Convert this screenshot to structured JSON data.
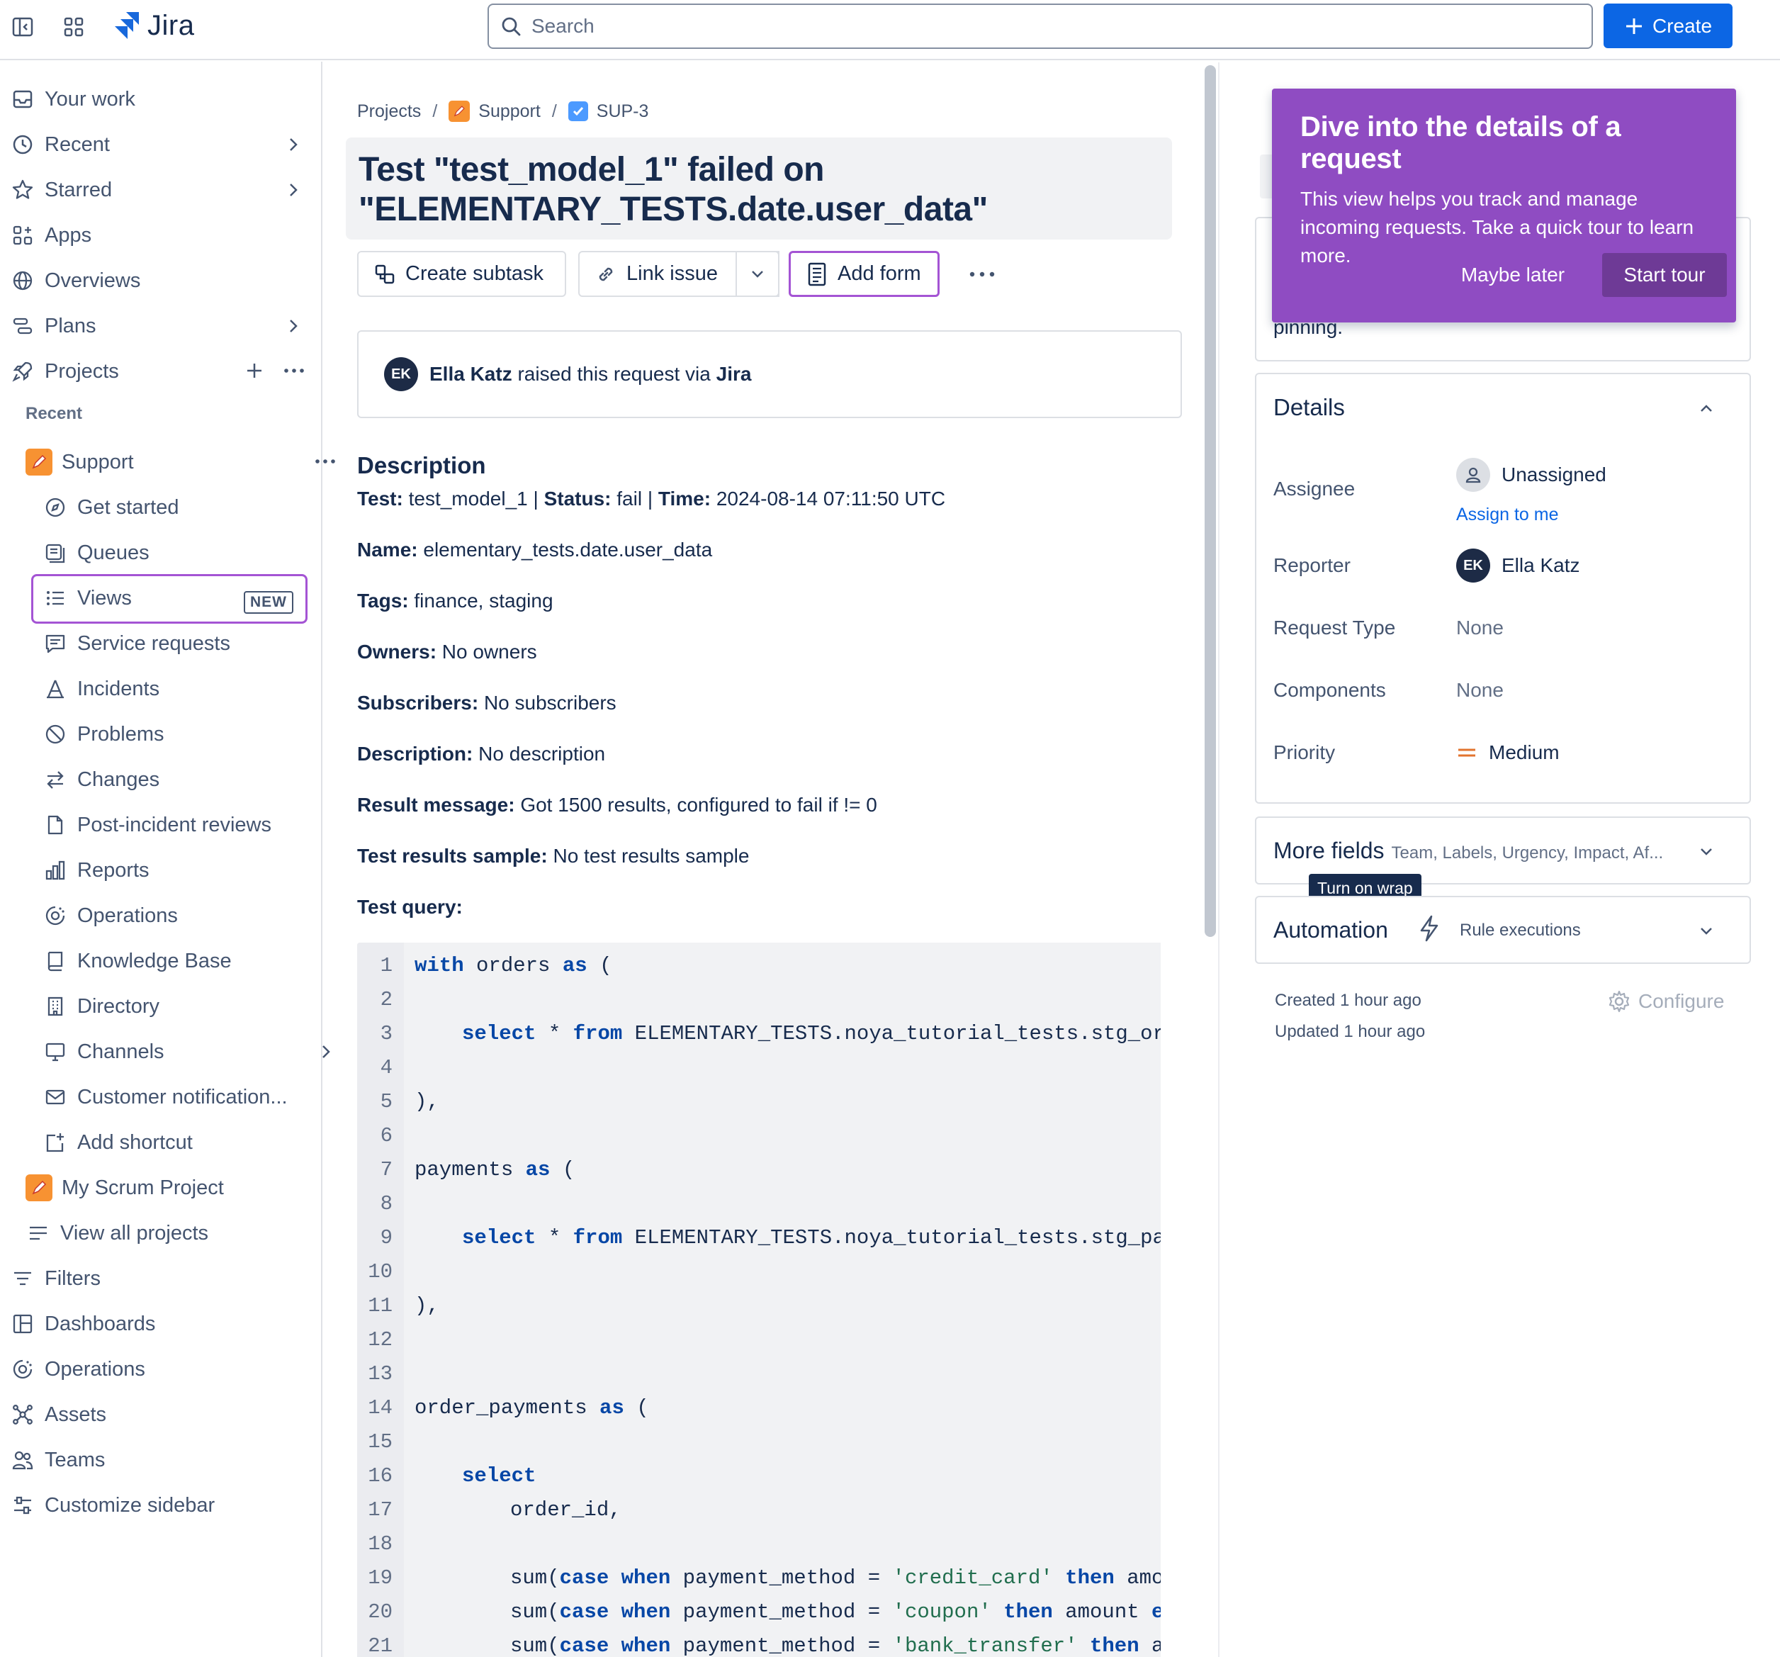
{
  "topbar": {
    "app_name": "Jira",
    "search_placeholder": "Search",
    "create_label": "Create"
  },
  "sidebar": {
    "your_work": "Your work",
    "recent": "Recent",
    "starred": "Starred",
    "apps": "Apps",
    "overviews": "Overviews",
    "plans": "Plans",
    "projects": "Projects",
    "recent_section": "Recent",
    "support": "Support",
    "support_items": [
      "Get started",
      "Queues",
      "Views",
      "Service requests",
      "Incidents",
      "Problems",
      "Changes",
      "Post-incident reviews",
      "Reports",
      "Operations",
      "Knowledge Base",
      "Directory",
      "Channels",
      "Customer notification...",
      "Add shortcut"
    ],
    "new_badge": "NEW",
    "my_scrum": "My Scrum Project",
    "view_all": "View all projects",
    "bottom_items": [
      "Filters",
      "Dashboards",
      "Operations",
      "Assets",
      "Teams",
      "Customize sidebar"
    ]
  },
  "breadcrumb": {
    "projects": "Projects",
    "support": "Support",
    "issue": "SUP-3"
  },
  "issue": {
    "title": "Test \"test_model_1\" failed on \"ELEMENTARY_TESTS.date.user_data\"",
    "create_subtask": "Create subtask",
    "link_issue": "Link issue",
    "add_form": "Add form",
    "raised_by": "Ella Katz",
    "raised_mid": " raised this request via ",
    "raised_via": "Jira",
    "avatar_initials": "EK"
  },
  "description": {
    "heading": "Description",
    "line1": {
      "k1": "Test:",
      "v1": " test_model_1 | ",
      "k2": "Status:",
      "v2": " fail | ",
      "k3": "Time:",
      "v3": " 2024-08-14 07:11:50 UTC"
    },
    "fields": [
      {
        "k": "Name:",
        "v": " elementary_tests.date.user_data"
      },
      {
        "k": "Tags:",
        "v": " finance, staging"
      },
      {
        "k": "Owners:",
        "v": " No owners"
      },
      {
        "k": "Subscribers:",
        "v": " No subscribers"
      },
      {
        "k": "Description:",
        "v": " No description"
      },
      {
        "k": "Result message:",
        "v": " Got 1500 results, configured to fail if != 0"
      },
      {
        "k": "Test results sample:",
        "v": " No test results sample"
      },
      {
        "k": "Test query:",
        "v": ""
      }
    ]
  },
  "code": {
    "line_numbers": [
      "1",
      "2",
      "3",
      "4",
      "5",
      "6",
      "7",
      "8",
      "9",
      "10",
      "11",
      "12",
      "13",
      "14",
      "15",
      "16",
      "17",
      "18",
      "19",
      "20",
      "21"
    ],
    "l1_a": "with",
    "l1_b": " orders ",
    "l1_c": "as",
    "l1_d": " (",
    "l3_a": "select",
    "l3_b": " * ",
    "l3_c": "from",
    "l3_d": " ELEMENTARY_TESTS.noya_tutorial_tests.stg_orders",
    "l5": "),",
    "l7_a": "payments ",
    "l7_b": "as",
    "l7_c": " (",
    "l9_a": "select",
    "l9_b": " * ",
    "l9_c": "from",
    "l9_d": " ELEMENTARY_TESTS.noya_tutorial_tests.stg_payments",
    "l11": "),",
    "l14_a": "order_payments ",
    "l14_b": "as",
    "l14_c": " (",
    "l16": "select",
    "l17": "order_id,",
    "l19_a": "sum(",
    "l19_b": "case",
    "l19_c": " ",
    "l19_d": "when",
    "l19_e": " payment_method = ",
    "l19_f": "'credit_card'",
    "l19_g": " ",
    "l19_h": "then",
    "l19_i": " amount",
    "l20_a": "sum(",
    "l20_b": "case",
    "l20_c": " ",
    "l20_d": "when",
    "l20_e": " payment_method = ",
    "l20_f": "'coupon'",
    "l20_g": " ",
    "l20_h": "then",
    "l20_i": " amount ",
    "l20_j": "else",
    "l21_a": "sum(",
    "l21_b": "case",
    "l21_c": " ",
    "l21_d": "when",
    "l21_e": " payment_method = ",
    "l21_f": "'bank_transfer'",
    "l21_g": " ",
    "l21_h": "then",
    "l21_i": " amount"
  },
  "tour": {
    "title": "Dive into the details of a request",
    "body": "This view helps you track and manage incoming requests. Take a quick tour to learn more.",
    "later": "Maybe later",
    "start": "Start tour"
  },
  "panel": {
    "pinning_text": "pinning.",
    "details_title": "Details",
    "assignee_label": "Assignee",
    "assignee_value": "Unassigned",
    "assign_to_me": "Assign to me",
    "reporter_label": "Reporter",
    "reporter_value": "Ella Katz",
    "request_type_label": "Request Type",
    "request_type_value": "None",
    "components_label": "Components",
    "components_value": "None",
    "priority_label": "Priority",
    "priority_value": "Medium",
    "more_fields": "More fields",
    "more_fields_hint": "Team, Labels, Urgency, Impact, Af...",
    "tooltip": "Turn on wrap",
    "automation": "Automation",
    "rule_executions": "Rule executions",
    "created": "Created 1 hour ago",
    "updated": "Updated 1 hour ago",
    "configure": "Configure"
  },
  "colors": {
    "accent": "#0c66e4",
    "tour_purple": "#8f4cc2",
    "highlight_border": "#a454d4",
    "priority_medium": "#e2742f"
  }
}
